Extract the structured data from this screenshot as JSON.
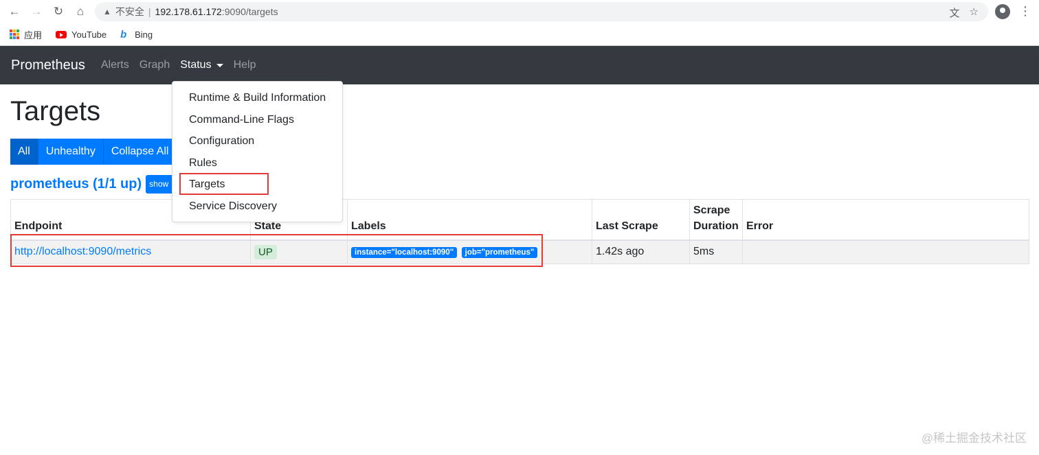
{
  "browser": {
    "url_insecure": "不安全",
    "url_host": "192.178.61.172",
    "url_path": ":9090/targets",
    "bookmarks": [
      {
        "label": "应用"
      },
      {
        "label": "YouTube"
      },
      {
        "label": "Bing"
      }
    ]
  },
  "navbar": {
    "brand": "Prometheus",
    "links": [
      {
        "label": "Alerts"
      },
      {
        "label": "Graph"
      },
      {
        "label": "Status"
      },
      {
        "label": "Help"
      }
    ]
  },
  "status_menu": {
    "items": [
      {
        "label": "Runtime & Build Information"
      },
      {
        "label": "Command-Line Flags"
      },
      {
        "label": "Configuration"
      },
      {
        "label": "Rules"
      },
      {
        "label": "Targets"
      },
      {
        "label": "Service Discovery"
      }
    ]
  },
  "page": {
    "title": "Targets",
    "filters": [
      {
        "label": "All",
        "active": true
      },
      {
        "label": "Unhealthy",
        "active": false
      },
      {
        "label": "Collapse All",
        "active": false
      }
    ],
    "job_title": "prometheus (1/1 up)",
    "show_less": "show less"
  },
  "table": {
    "headers": {
      "endpoint": "Endpoint",
      "state": "State",
      "labels": "Labels",
      "last_scrape": "Last Scrape",
      "scrape_duration_line1": "Scrape",
      "scrape_duration_line2": "Duration",
      "error": "Error"
    },
    "rows": [
      {
        "endpoint": "http://localhost:9090/metrics",
        "state": "UP",
        "labels": [
          "instance=\"localhost:9090\"",
          "job=\"prometheus\""
        ],
        "last_scrape": "1.42s ago",
        "scrape_duration": "5ms",
        "error": ""
      }
    ]
  },
  "colors": {
    "navbar_bg": "#343a40",
    "primary": "#007bff",
    "highlight_box": "#e53935",
    "up_badge_bg": "#d4edda"
  },
  "watermark": "@稀土掘金技术社区"
}
